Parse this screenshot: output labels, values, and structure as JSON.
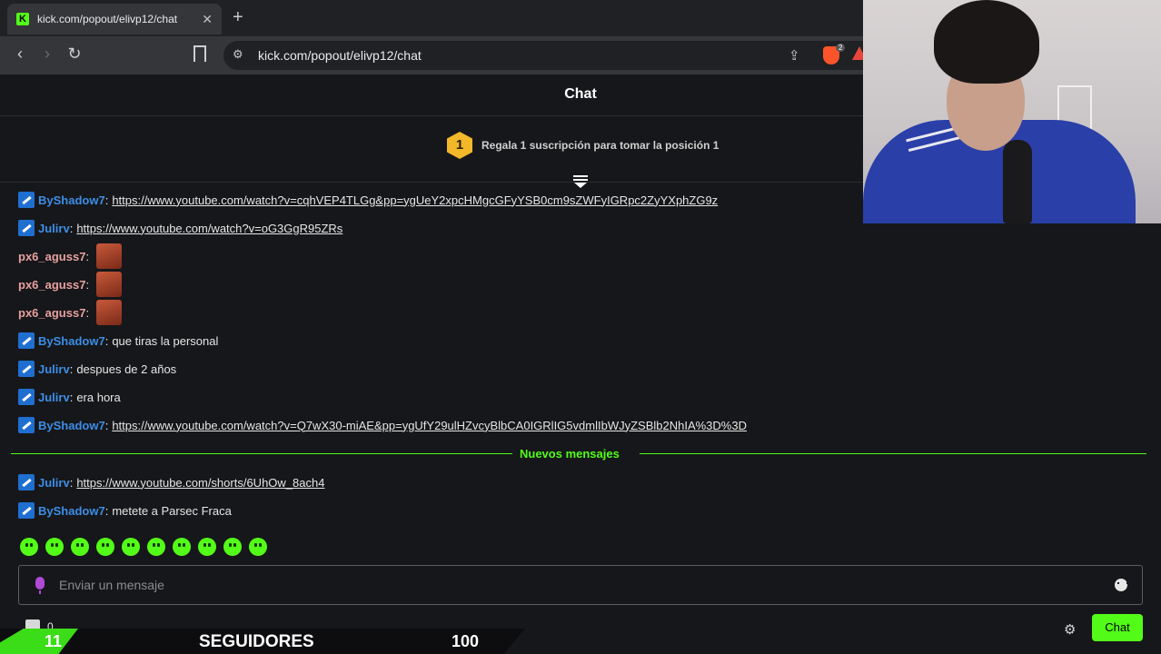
{
  "browser": {
    "tab_title": "kick.com/popout/elivp12/chat",
    "tab_favicon": "K",
    "url": "kick.com/popout/elivp12/chat",
    "extension_badge": "2"
  },
  "chat": {
    "title": "Chat",
    "pinned": {
      "rank": "1",
      "text": "Regala 1 suscripción para tomar la posición 1"
    },
    "messages": [
      {
        "user": "ByShadow7",
        "badge": true,
        "text": "https://www.youtube.com/watch?v=cqhVEP4TLGg&pp=ygUeY2xpcHMgcGFyYSB0cm9sZWFyIGRpc2ZyYXphZG9z",
        "is_link": true
      },
      {
        "user": "Julirv",
        "badge": true,
        "text": "https://www.youtube.com/watch?v=oG3GgR95ZRs",
        "is_link": true
      },
      {
        "user": "px6_aguss7",
        "badge": false,
        "emote": true
      },
      {
        "user": "px6_aguss7",
        "badge": false,
        "emote": true
      },
      {
        "user": "px6_aguss7",
        "badge": false,
        "emote": true
      },
      {
        "user": "ByShadow7",
        "badge": true,
        "text": "que tiras la personal",
        "is_link": false
      },
      {
        "user": "Julirv",
        "badge": true,
        "text": "despues de 2 años",
        "is_link": false
      },
      {
        "user": "Julirv",
        "badge": true,
        "text": "era hora",
        "is_link": false
      },
      {
        "user": "ByShadow7",
        "badge": true,
        "text": "https://www.youtube.com/watch?v=Q7wX30-miAE&pp=ygUfY29ulHZvcyBlbCA0IGRlIG5vdmlIbWJyZSBlb2NhIA%3D%3D",
        "is_link": true
      }
    ],
    "new_messages_label": "Nuevos mensajes",
    "new_messages": [
      {
        "user": "Julirv",
        "badge": true,
        "text": "https://www.youtube.com/shorts/6UhOw_8ach4",
        "is_link": true
      },
      {
        "user": "ByShadow7",
        "badge": true,
        "text": "metete a Parsec Fraca",
        "is_link": false
      }
    ],
    "quick_emote_count": 10,
    "input_placeholder": "Enviar un mensaje",
    "send_label": "Chat",
    "watchers": "0"
  },
  "overlay": {
    "followers_current": "11",
    "followers_label": "SEGUIDORES",
    "followers_goal": "100"
  },
  "colors": {
    "kick_green": "#53fc18",
    "username_blue": "#3c8ee7",
    "username_pink": "#e8a0a0",
    "background": "#16171a"
  }
}
